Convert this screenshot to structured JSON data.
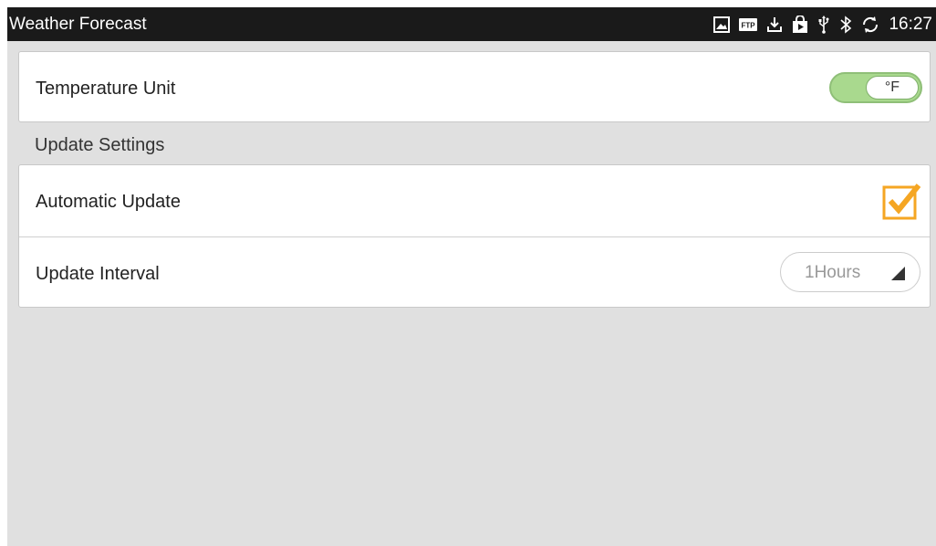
{
  "statusbar": {
    "app_title": "Weather Forecast",
    "time": "16:27",
    "icons": [
      "gallery-icon",
      "ftp-icon",
      "download-icon",
      "store-icon",
      "usb-icon",
      "bluetooth-icon",
      "sync-icon"
    ],
    "ftp_label": "FTP"
  },
  "temperature": {
    "label": "Temperature Unit",
    "unit_value": "°F",
    "toggle_on_color": "#a9d98e"
  },
  "update_section": {
    "header": "Update Settings",
    "automatic_update_label": "Automatic Update",
    "automatic_update_checked": true,
    "check_color": "#f5a623",
    "interval_label": "Update Interval",
    "interval_value": "1Hours"
  }
}
